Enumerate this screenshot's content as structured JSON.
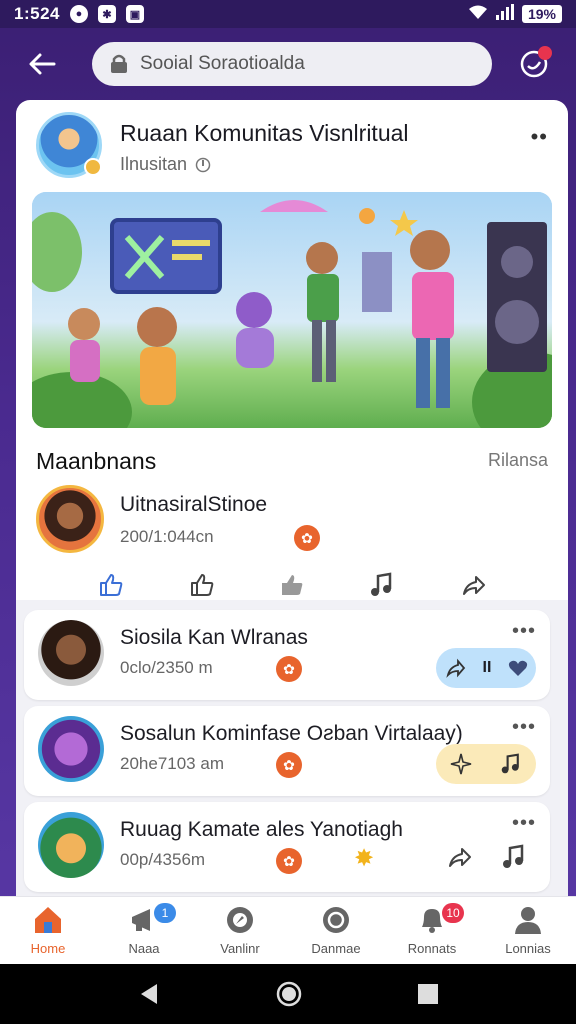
{
  "status_bar": {
    "time": "1:524",
    "battery": "19%"
  },
  "search": {
    "placeholder": "Sooial Soraotioalda"
  },
  "post": {
    "title": "Ruaan Komunitas Visnlritual",
    "subtitle": "Ilnusitan",
    "section_label": "Maanbnans",
    "section_link": "Rilansa",
    "comment": {
      "name": "UitnasiralStinoe",
      "meta": "200/1:044cn"
    }
  },
  "feed": [
    {
      "title": "Siosila Kan Wlranas",
      "meta": "0clo/2350 m",
      "pill": "blue"
    },
    {
      "title": "Sosalun Kominfase Oƨban Virtalaay)",
      "meta": "20he7103 am",
      "pill": "yellow"
    },
    {
      "title": "Ruuag Kamate ales Yanotiagh",
      "meta": "00p/4356m",
      "pill": "none"
    }
  ],
  "nav": [
    {
      "label": "Home",
      "badge": ""
    },
    {
      "label": "Naaa",
      "badge": "1"
    },
    {
      "label": "Vanlinr",
      "badge": ""
    },
    {
      "label": "Danmae",
      "badge": ""
    },
    {
      "label": "Ronnats",
      "badge": "10"
    },
    {
      "label": "Lonnias",
      "badge": ""
    }
  ],
  "colors": {
    "accent": "#e8642d",
    "brand": "#4a2a8f",
    "badge_blue": "#3b8be8",
    "badge_red": "#e8344e"
  }
}
